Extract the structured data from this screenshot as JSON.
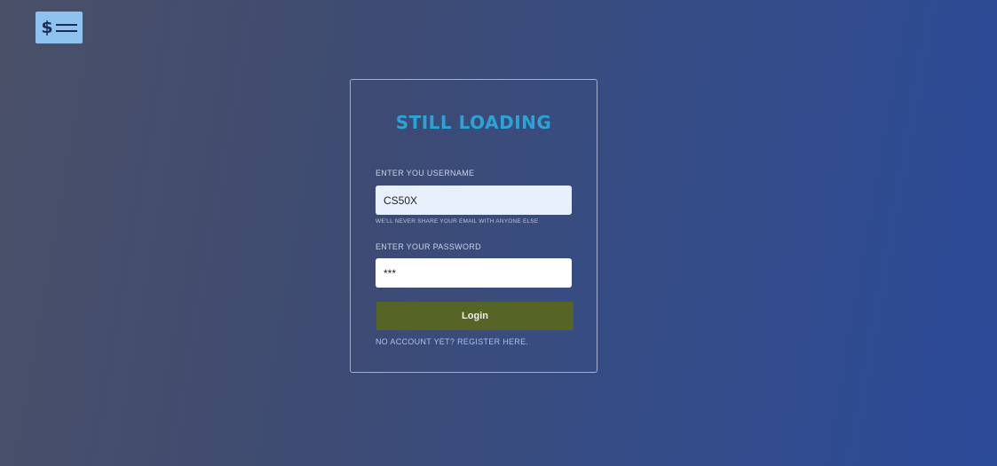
{
  "brand": {
    "logo_symbol": "$",
    "logo_icon": "money-bill-icon",
    "logo_color": "#8ec3f0"
  },
  "login_form": {
    "title": "STILL LOADING",
    "title_color": "#2ba3d6",
    "username_label": "ENTER YOU USERNAME",
    "username_value": "CS50X",
    "username_hint": "WE'LL NEVER SHARE YOUR EMAIL WITH ANYONE ELSE",
    "password_label": "ENTER YOUR PASSWORD",
    "password_value": "***",
    "login_button_label": "Login",
    "login_button_color": "#566425",
    "register_link_text": "NO ACCOUNT YET? REGISTER HERE."
  }
}
